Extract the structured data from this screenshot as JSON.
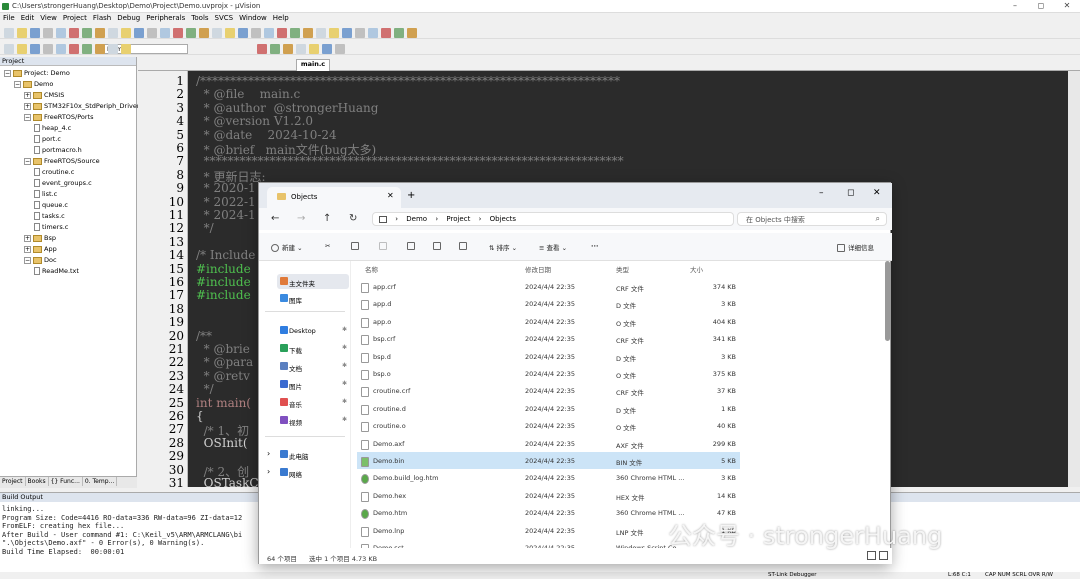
{
  "window": {
    "title": "C:\\Users\\strongerHuang\\Desktop\\Demo\\Project\\Demo.uvprojx - µVision"
  },
  "menu": [
    "File",
    "Edit",
    "View",
    "Project",
    "Flash",
    "Debug",
    "Peripherals",
    "Tools",
    "SVCS",
    "Window",
    "Help"
  ],
  "toolbar": {
    "target": "Demo"
  },
  "project_panel": {
    "title": "Project",
    "items": [
      {
        "label": "Project: Demo",
        "depth": 0,
        "type": "root"
      },
      {
        "label": "Demo",
        "depth": 1,
        "type": "target"
      },
      {
        "label": "CMSIS",
        "depth": 2,
        "type": "folder"
      },
      {
        "label": "STM32F10x_StdPeriph_Driver",
        "depth": 2,
        "type": "folder"
      },
      {
        "label": "FreeRTOS/Ports",
        "depth": 2,
        "type": "folder"
      },
      {
        "label": "heap_4.c",
        "depth": 3,
        "type": "file"
      },
      {
        "label": "port.c",
        "depth": 3,
        "type": "file"
      },
      {
        "label": "portmacro.h",
        "depth": 3,
        "type": "file"
      },
      {
        "label": "FreeRTOS/Source",
        "depth": 2,
        "type": "folder"
      },
      {
        "label": "croutine.c",
        "depth": 3,
        "type": "file"
      },
      {
        "label": "event_groups.c",
        "depth": 3,
        "type": "file"
      },
      {
        "label": "list.c",
        "depth": 3,
        "type": "file"
      },
      {
        "label": "queue.c",
        "depth": 3,
        "type": "file"
      },
      {
        "label": "tasks.c",
        "depth": 3,
        "type": "file"
      },
      {
        "label": "timers.c",
        "depth": 3,
        "type": "file"
      },
      {
        "label": "Bsp",
        "depth": 2,
        "type": "folder"
      },
      {
        "label": "App",
        "depth": 2,
        "type": "folder"
      },
      {
        "label": "Doc",
        "depth": 2,
        "type": "folder"
      },
      {
        "label": "ReadMe.txt",
        "depth": 3,
        "type": "file"
      }
    ],
    "tabs": [
      "Project",
      "Books",
      "{} Func...",
      "0. Temp..."
    ]
  },
  "editor": {
    "tab": "main.c",
    "lines": [
      {
        "n": "1",
        "t": "/**********************************************************************",
        "c": "cm"
      },
      {
        "n": "2",
        "t": "  * @file    main.c",
        "c": "cm"
      },
      {
        "n": "3",
        "t": "  * @author  @strongerHuang",
        "c": "cm"
      },
      {
        "n": "4",
        "t": "  * @version V1.2.0",
        "c": "cm"
      },
      {
        "n": "5",
        "t": "  * @date    2024-10-24",
        "c": "cm"
      },
      {
        "n": "6",
        "t": "  * @brief   main文件(bug太多)",
        "c": "cm"
      },
      {
        "n": "7",
        "t": "  **********************************************************************",
        "c": "cm"
      },
      {
        "n": "8",
        "t": "  * 更新日志:",
        "c": "cm"
      },
      {
        "n": "9",
        "t": "  * 2020-1",
        "c": "cm"
      },
      {
        "n": "10",
        "t": "  * 2022-1",
        "c": "cm"
      },
      {
        "n": "11",
        "t": "  * 2024-1",
        "c": "cm"
      },
      {
        "n": "12",
        "t": "  */",
        "c": "cm"
      },
      {
        "n": "13",
        "t": "",
        "c": "cm"
      },
      {
        "n": "14",
        "t": "/* Include",
        "c": "cm"
      },
      {
        "n": "15",
        "t": "#include",
        "c": "cinc"
      },
      {
        "n": "16",
        "t": "#include",
        "c": "cinc"
      },
      {
        "n": "17",
        "t": "#include",
        "c": "cinc"
      },
      {
        "n": "18",
        "t": "",
        "c": "cm"
      },
      {
        "n": "19",
        "t": "",
        "c": "cm"
      },
      {
        "n": "20",
        "t": "/**",
        "c": "cm"
      },
      {
        "n": "21",
        "t": "  * @brie",
        "c": "cm"
      },
      {
        "n": "22",
        "t": "  * @para",
        "c": "cm"
      },
      {
        "n": "23",
        "t": "  * @retv",
        "c": "cm"
      },
      {
        "n": "24",
        "t": "  */",
        "c": "cm"
      },
      {
        "n": "25",
        "t": "int main(",
        "c": "ckw"
      },
      {
        "n": "26",
        "t": "{",
        "c": ""
      },
      {
        "n": "27",
        "t": "  /* 1、初",
        "c": "cm"
      },
      {
        "n": "28",
        "t": "  OSInit(",
        "c": ""
      },
      {
        "n": "29",
        "t": "",
        "c": ""
      },
      {
        "n": "30",
        "t": "  /* 2、创",
        "c": "cm"
      },
      {
        "n": "31",
        "t": "  OSTaskCr",
        "c": ""
      }
    ]
  },
  "build_output": {
    "title": "Build Output",
    "lines": [
      "linking...",
      "Program Size: Code=4416 RO-data=336 RW-data=96 ZI-data=12",
      "FromELF: creating hex file...",
      "After Build - User command #1: C:\\Keil_v5\\ARM\\ARMCLANG\\bi",
      "\".\\Objects\\Demo.axf\" - 0 Error(s), 0 Warning(s).",
      "Build Time Elapsed:  00:00:01"
    ]
  },
  "statusbar": {
    "debugger": "ST-Link Debugger",
    "pos": "L:68 C:1",
    "flags": "CAP  NUM  SCRL  OVR  R/W"
  },
  "explorer": {
    "tab_title": "Objects",
    "breadcrumb": [
      "Demo",
      "Project",
      "Objects"
    ],
    "search_placeholder": "在 Objects 中搜索",
    "commands": {
      "new": "新建",
      "sort": "排序",
      "view": "查看",
      "details": "详细信息"
    },
    "nav": [
      {
        "label": "主文件夹",
        "color": "#e07a3a",
        "pin": false
      },
      {
        "label": "图库",
        "color": "#3a8ae0",
        "pin": false
      },
      {
        "label": "Desktop",
        "color": "#2f7de0",
        "pin": true
      },
      {
        "label": "下载",
        "color": "#2aa05a",
        "pin": true
      },
      {
        "label": "文档",
        "color": "#5a7fc0",
        "pin": true
      },
      {
        "label": "图片",
        "color": "#3a6ad0",
        "pin": true
      },
      {
        "label": "音乐",
        "color": "#e05050",
        "pin": true
      },
      {
        "label": "视频",
        "color": "#8050c0",
        "pin": true
      },
      {
        "label": "此电脑",
        "color": "#3a7ad0",
        "pin": false
      },
      {
        "label": "网络",
        "color": "#3a7ad0",
        "pin": false
      }
    ],
    "columns": [
      "名称",
      "修改日期",
      "类型",
      "大小"
    ],
    "files": [
      {
        "name": "app.crf",
        "date": "2024/4/4 22:35",
        "type": "CRF 文件",
        "size": "374 KB"
      },
      {
        "name": "app.d",
        "date": "2024/4/4 22:35",
        "type": "D 文件",
        "size": "3 KB"
      },
      {
        "name": "app.o",
        "date": "2024/4/4 22:35",
        "type": "O 文件",
        "size": "404 KB"
      },
      {
        "name": "bsp.crf",
        "date": "2024/4/4 22:35",
        "type": "CRF 文件",
        "size": "341 KB"
      },
      {
        "name": "bsp.d",
        "date": "2024/4/4 22:35",
        "type": "D 文件",
        "size": "3 KB"
      },
      {
        "name": "bsp.o",
        "date": "2024/4/4 22:35",
        "type": "O 文件",
        "size": "375 KB"
      },
      {
        "name": "croutine.crf",
        "date": "2024/4/4 22:35",
        "type": "CRF 文件",
        "size": "37 KB"
      },
      {
        "name": "croutine.d",
        "date": "2024/4/4 22:35",
        "type": "D 文件",
        "size": "1 KB"
      },
      {
        "name": "croutine.o",
        "date": "2024/4/4 22:35",
        "type": "O 文件",
        "size": "40 KB"
      },
      {
        "name": "Demo.axf",
        "date": "2024/4/4 22:35",
        "type": "AXF 文件",
        "size": "299 KB"
      },
      {
        "name": "Demo.bin",
        "date": "2024/4/4 22:35",
        "type": "BIN 文件",
        "size": "5 KB",
        "selected": true
      },
      {
        "name": "Demo.build_log.htm",
        "date": "2024/4/4 22:35",
        "type": "360 Chrome HTML ...",
        "size": "3 KB"
      },
      {
        "name": "Demo.hex",
        "date": "2024/4/4 22:35",
        "type": "HEX 文件",
        "size": "14 KB"
      },
      {
        "name": "Demo.htm",
        "date": "2024/4/4 22:35",
        "type": "360 Chrome HTML ...",
        "size": "47 KB"
      },
      {
        "name": "Demo.lnp",
        "date": "2024/4/4 22:35",
        "type": "LNP 文件",
        "size": "1 KB"
      },
      {
        "name": "Demo.sct",
        "date": "2024/4/4 22:35",
        "type": "Windows Script Co...",
        "size": ""
      }
    ],
    "status": {
      "count": "64 个项目",
      "selected": "选中 1 个项目  4.73 KB"
    }
  },
  "watermark": "公众号 · strongerHuang"
}
